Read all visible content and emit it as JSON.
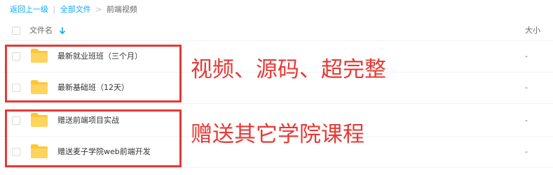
{
  "breadcrumb": {
    "back": "返回上一级",
    "separator": "|",
    "all_files": "全部文件",
    "arrow": ">",
    "current": "前端视频"
  },
  "header": {
    "name_label": "文件名",
    "size_label": "大小"
  },
  "files": [
    {
      "name": "最新就业班班（三个月）",
      "size": "-"
    },
    {
      "name": "最新基础班（12天）",
      "size": "-"
    },
    {
      "name": "赠送前端项目实战",
      "size": "-"
    },
    {
      "name": "赠送麦子学院web前端开发",
      "size": "-"
    }
  ],
  "annotations": [
    {
      "text": "视频、源码、超完整"
    },
    {
      "text": "赠送其它学院课程"
    }
  ],
  "colors": {
    "link": "#09aaff",
    "folder": "#ffc636",
    "annotation": "#e53935"
  },
  "icons": {
    "folder": "folder-icon",
    "sort": "sort-down-arrow-icon"
  }
}
